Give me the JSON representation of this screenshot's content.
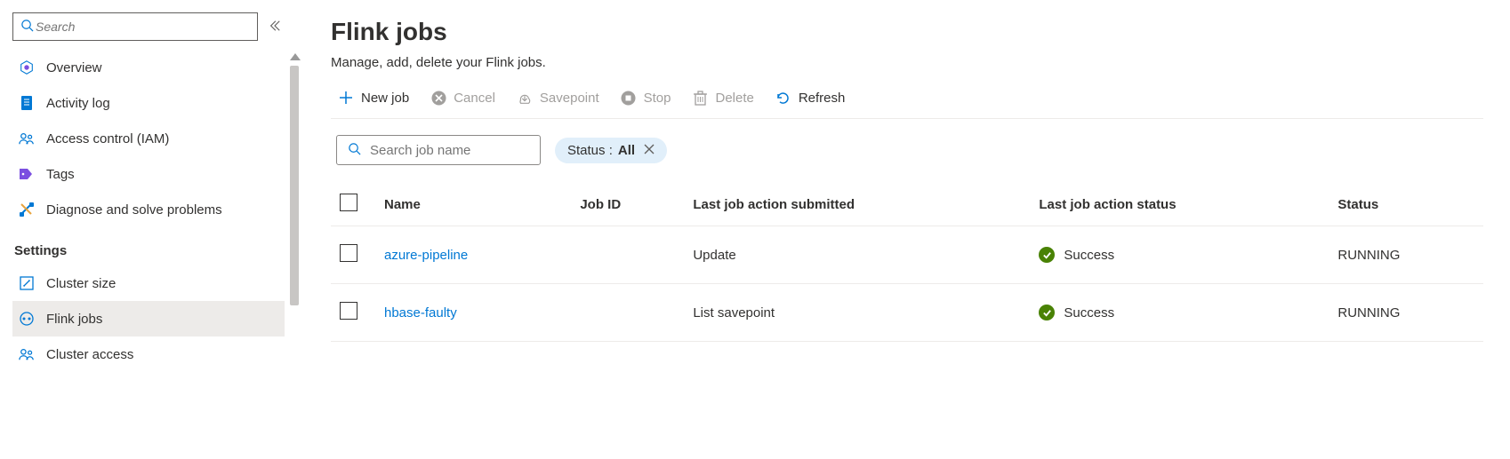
{
  "sidebar": {
    "search_placeholder": "Search",
    "items": [
      {
        "label": "Overview",
        "icon": "overview-icon"
      },
      {
        "label": "Activity log",
        "icon": "activity-log-icon"
      },
      {
        "label": "Access control (IAM)",
        "icon": "access-control-icon"
      },
      {
        "label": "Tags",
        "icon": "tags-icon"
      },
      {
        "label": "Diagnose and solve problems",
        "icon": "diagnose-icon"
      }
    ],
    "section_label": "Settings",
    "settings_items": [
      {
        "label": "Cluster size",
        "icon": "cluster-size-icon",
        "selected": false
      },
      {
        "label": "Flink jobs",
        "icon": "flink-jobs-icon",
        "selected": true
      },
      {
        "label": "Cluster access",
        "icon": "cluster-access-icon",
        "selected": false
      }
    ]
  },
  "main": {
    "title": "Flink jobs",
    "subtitle": "Manage, add, delete your Flink jobs.",
    "toolbar": {
      "new_job": "New job",
      "cancel": "Cancel",
      "savepoint": "Savepoint",
      "stop": "Stop",
      "delete": "Delete",
      "refresh": "Refresh"
    },
    "job_search_placeholder": "Search job name",
    "filter": {
      "label": "Status :",
      "value": "All"
    },
    "columns": {
      "name": "Name",
      "job_id": "Job ID",
      "last_action_submitted": "Last job action submitted",
      "last_action_status": "Last job action status",
      "status": "Status"
    },
    "rows": [
      {
        "name": "azure-pipeline",
        "job_id": "",
        "last_action_submitted": "Update",
        "last_action_status": "Success",
        "status": "RUNNING"
      },
      {
        "name": "hbase-faulty",
        "job_id": "",
        "last_action_submitted": "List savepoint",
        "last_action_status": "Success",
        "status": "RUNNING"
      }
    ]
  }
}
